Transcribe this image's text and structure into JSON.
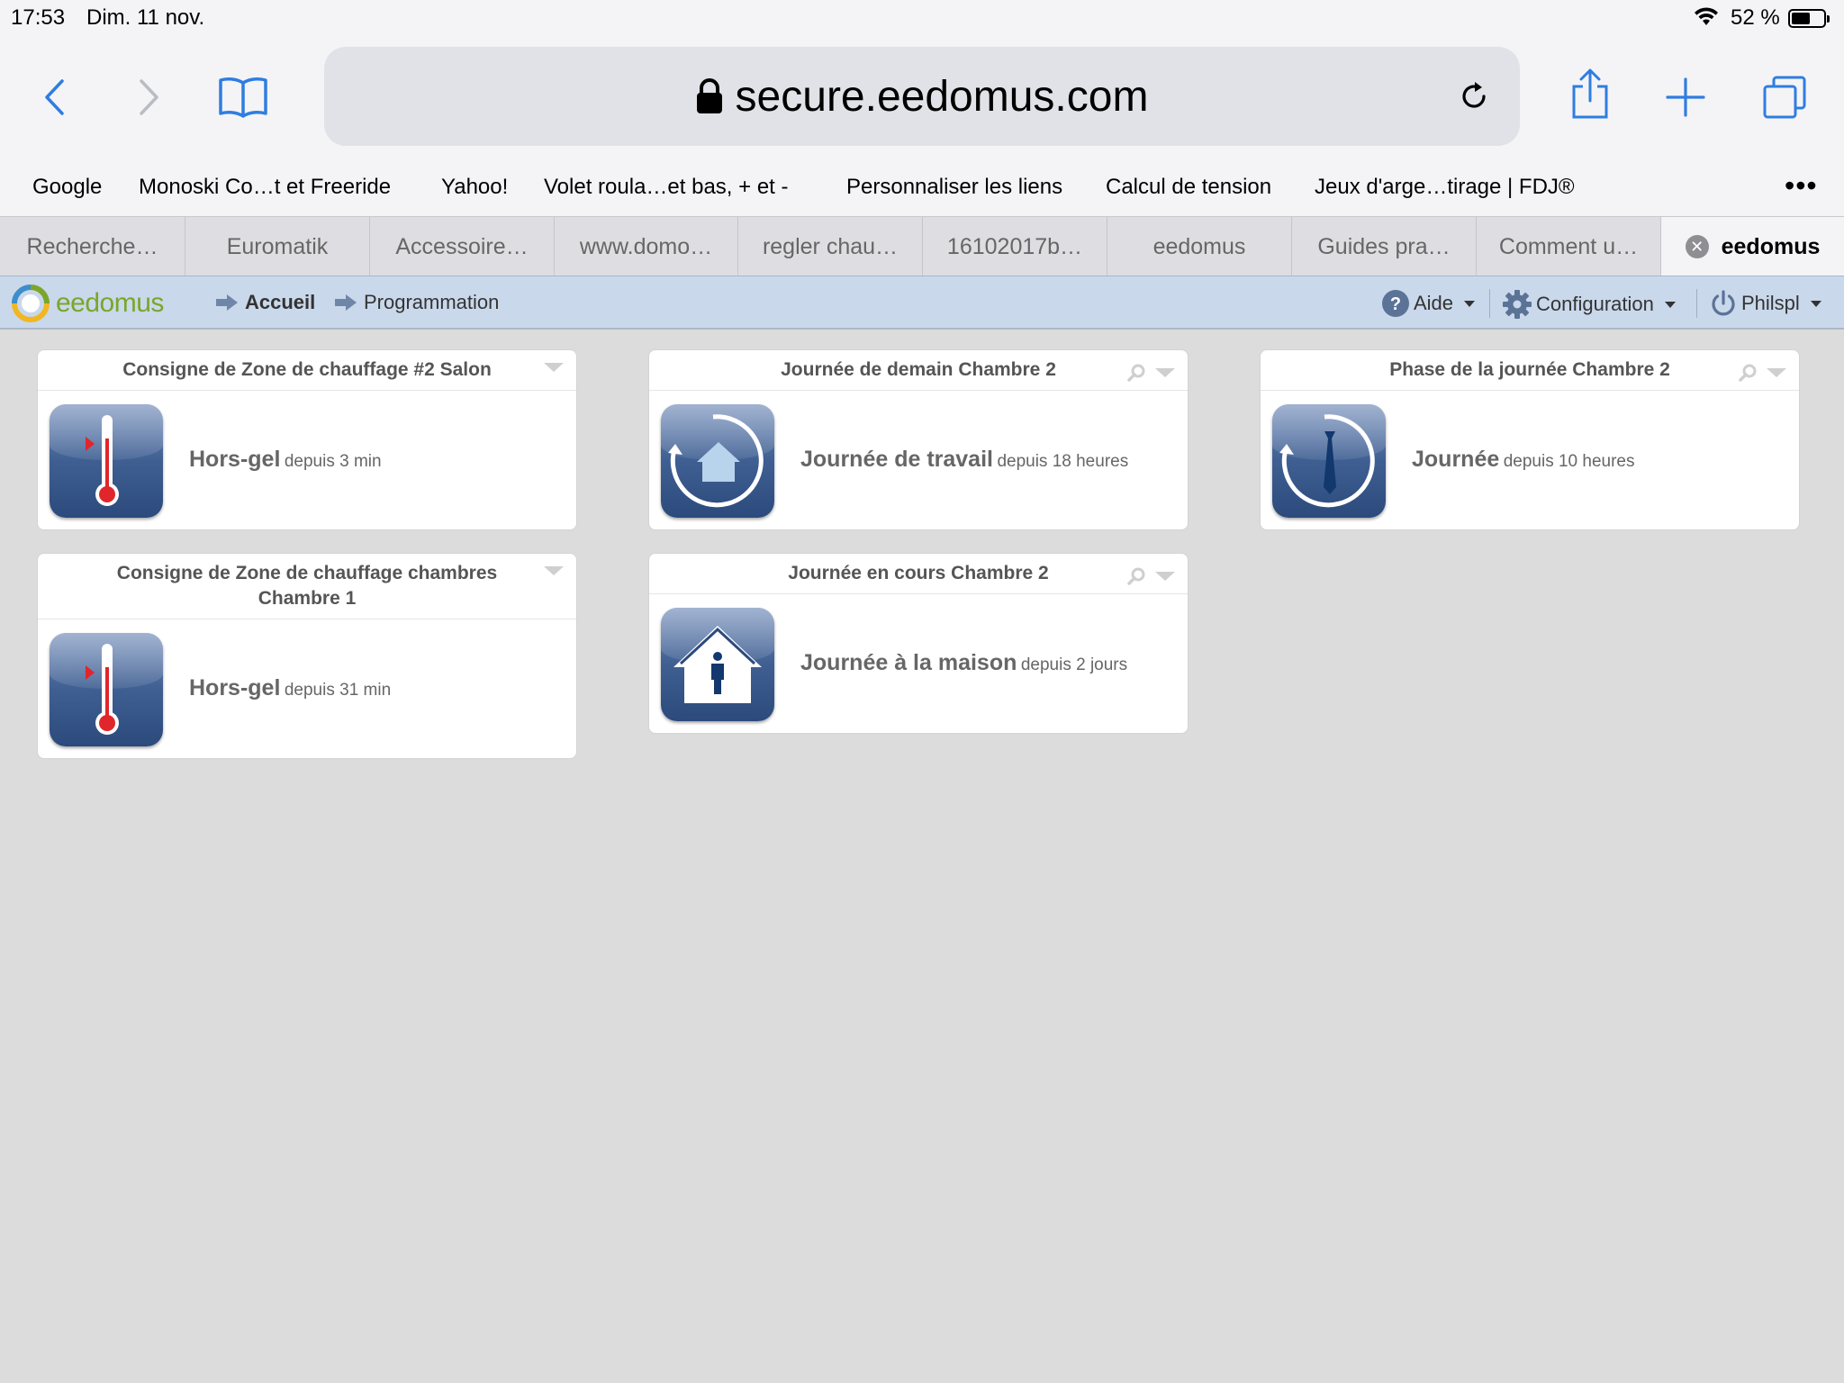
{
  "status_bar": {
    "time": "17:53",
    "date": "Dim. 11 nov.",
    "battery": "52 %"
  },
  "browser": {
    "url": "secure.eedomus.com",
    "favorites": [
      "Google",
      "Monoski Co…t et Freeride",
      "Yahoo!",
      "Volet roula…et bas, + et -",
      "Personnaliser les liens",
      "Calcul de tension",
      "Jeux d'arge…tirage | FDJ®"
    ],
    "tabs": [
      "Recherche…",
      "Euromatik",
      "Accessoire…",
      "www.domo…",
      "regler chau…",
      "16102017b…",
      "eedomus",
      "Guides pra…",
      "Comment u…",
      "eedomus"
    ]
  },
  "app": {
    "logo": "eedomus",
    "breadcrumb": [
      "Accueil",
      "Programmation"
    ],
    "menus": {
      "help": "Aide",
      "config": "Configuration",
      "user": "Philspl"
    },
    "cards": [
      {
        "title": "Consigne de Zone de chauffage #2 Salon",
        "value": "Hors-gel",
        "since": "depuis 3 min",
        "icon": "thermometer-icon"
      },
      {
        "title": "Journée de demain Chambre 2",
        "value": "Journée de travail",
        "since": "depuis 18 heures",
        "icon": "house-cycle-icon"
      },
      {
        "title": "Phase de la journée Chambre 2",
        "value": "Journée",
        "since": "depuis 10 heures",
        "icon": "tie-cycle-icon"
      },
      {
        "title": "Consigne de Zone de chauffage chambres Chambre 1",
        "value": "Hors-gel",
        "since": "depuis 31 min",
        "icon": "thermometer-icon"
      },
      {
        "title": "Journée en cours Chambre 2",
        "value": "Journée à la maison",
        "since": "depuis 2 jours",
        "icon": "house-person-icon"
      }
    ]
  },
  "colors": {
    "appbar": "#c9d8eb",
    "icon_blue": "#3f5f92",
    "logo_green": "#7aa62a",
    "ios_blue": "#2f7de1"
  }
}
